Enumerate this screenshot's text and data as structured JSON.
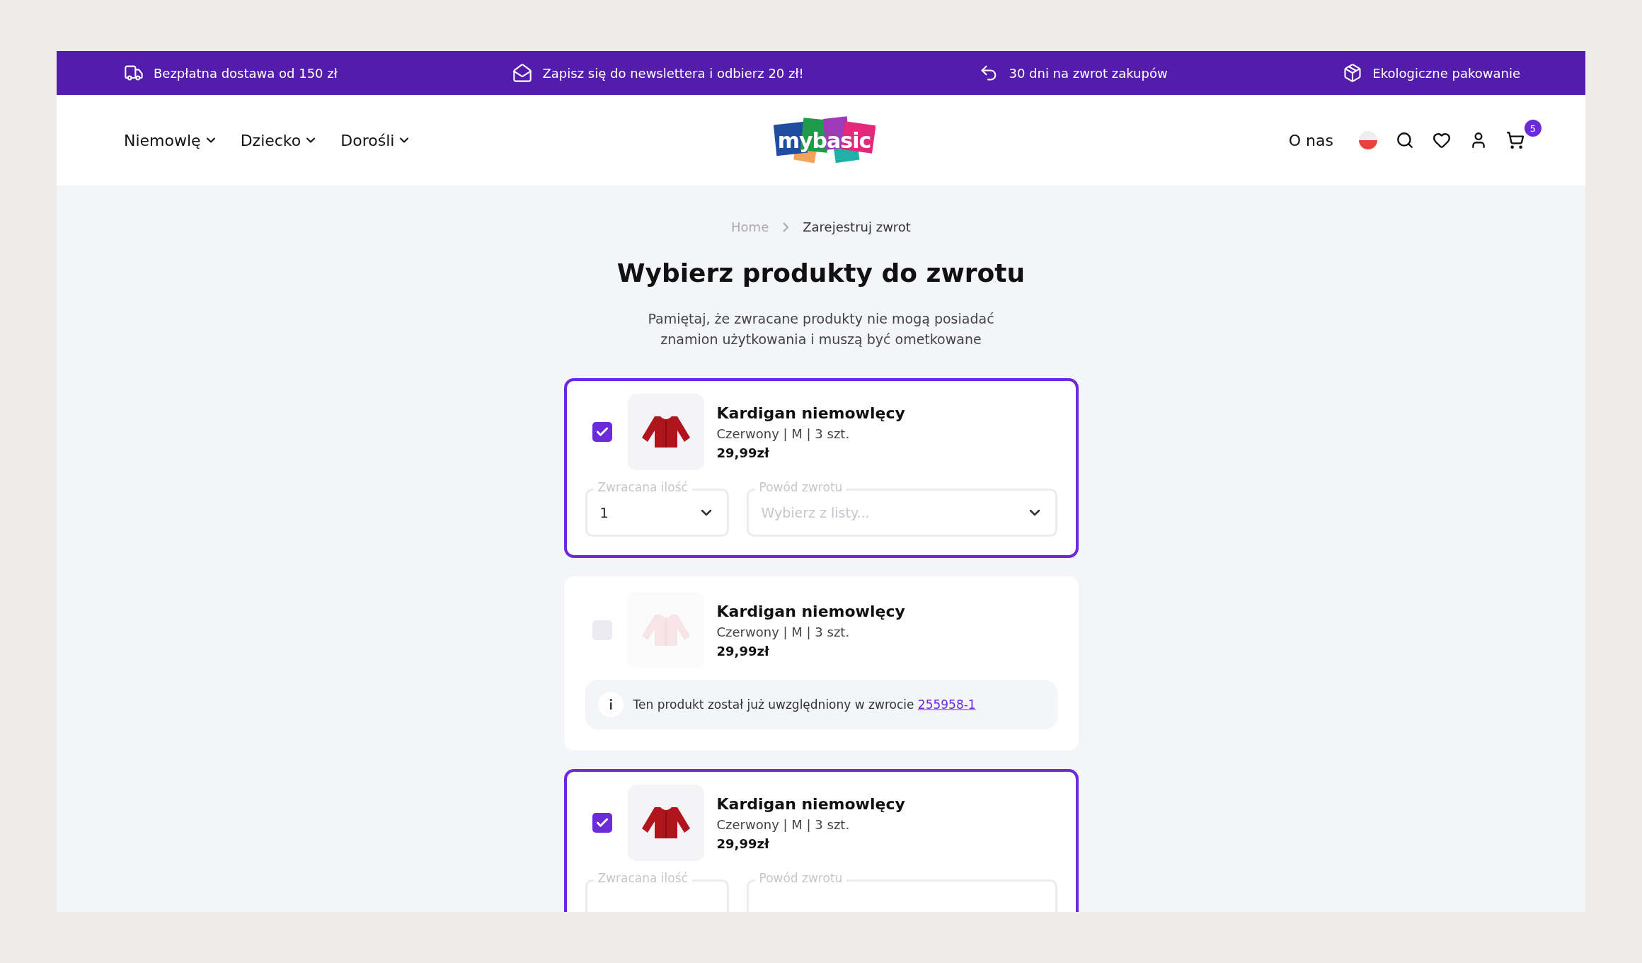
{
  "promo_bar": [
    "Bezpłatna dostawa od 150 zł",
    "Zapisz się do newslettera i odbierz 20 zł!",
    "30 dni na zwrot zakupów",
    "Ekologiczne pakowanie"
  ],
  "header": {
    "nav": [
      "Niemowlę",
      "Dziecko",
      "Dorośli"
    ],
    "logo": {
      "part_1": "my",
      "part_2": "basic"
    },
    "about_link": "O nas",
    "cart_count": "5"
  },
  "breadcrumb": [
    "Home",
    "Zarejestruj zwrot"
  ],
  "title": "Wybierz produkty do zwrotu",
  "subtitle": [
    "Pamiętaj, że zwracane produkty nie mogą posiadać",
    "znamion użytkowania i muszą być ometkowane"
  ],
  "items": [
    {
      "kind": "form",
      "checked": true,
      "disabled": false,
      "name": "Kardigan niemowlęcy",
      "details": "Czerwony | M | 3 szt.",
      "price": "29,99zł",
      "fields": [
        {
          "label": "Zwracana ilość",
          "value": "1"
        },
        {
          "label": "Powód zwrotu",
          "placeholder": "Wybierz z listy..."
        }
      ]
    },
    {
      "kind": "notice",
      "checked": false,
      "disabled": true,
      "name": "Kardigan niemowlęcy",
      "details": "Czerwony | M | 3 szt.",
      "price": "29,99zł",
      "notice": {
        "text": "Ten produkt został już uwzględniony w zwrocie",
        "link": "255958-1"
      }
    },
    {
      "kind": "form",
      "checked": true,
      "disabled": false,
      "name": "Kardigan niemowlęcy",
      "details": "Czerwony | M | 3 szt.",
      "price": "29,99zł",
      "fields": [
        {
          "label": "Zwracana ilość"
        },
        {
          "label": "Powód zwrotu"
        }
      ]
    }
  ]
}
